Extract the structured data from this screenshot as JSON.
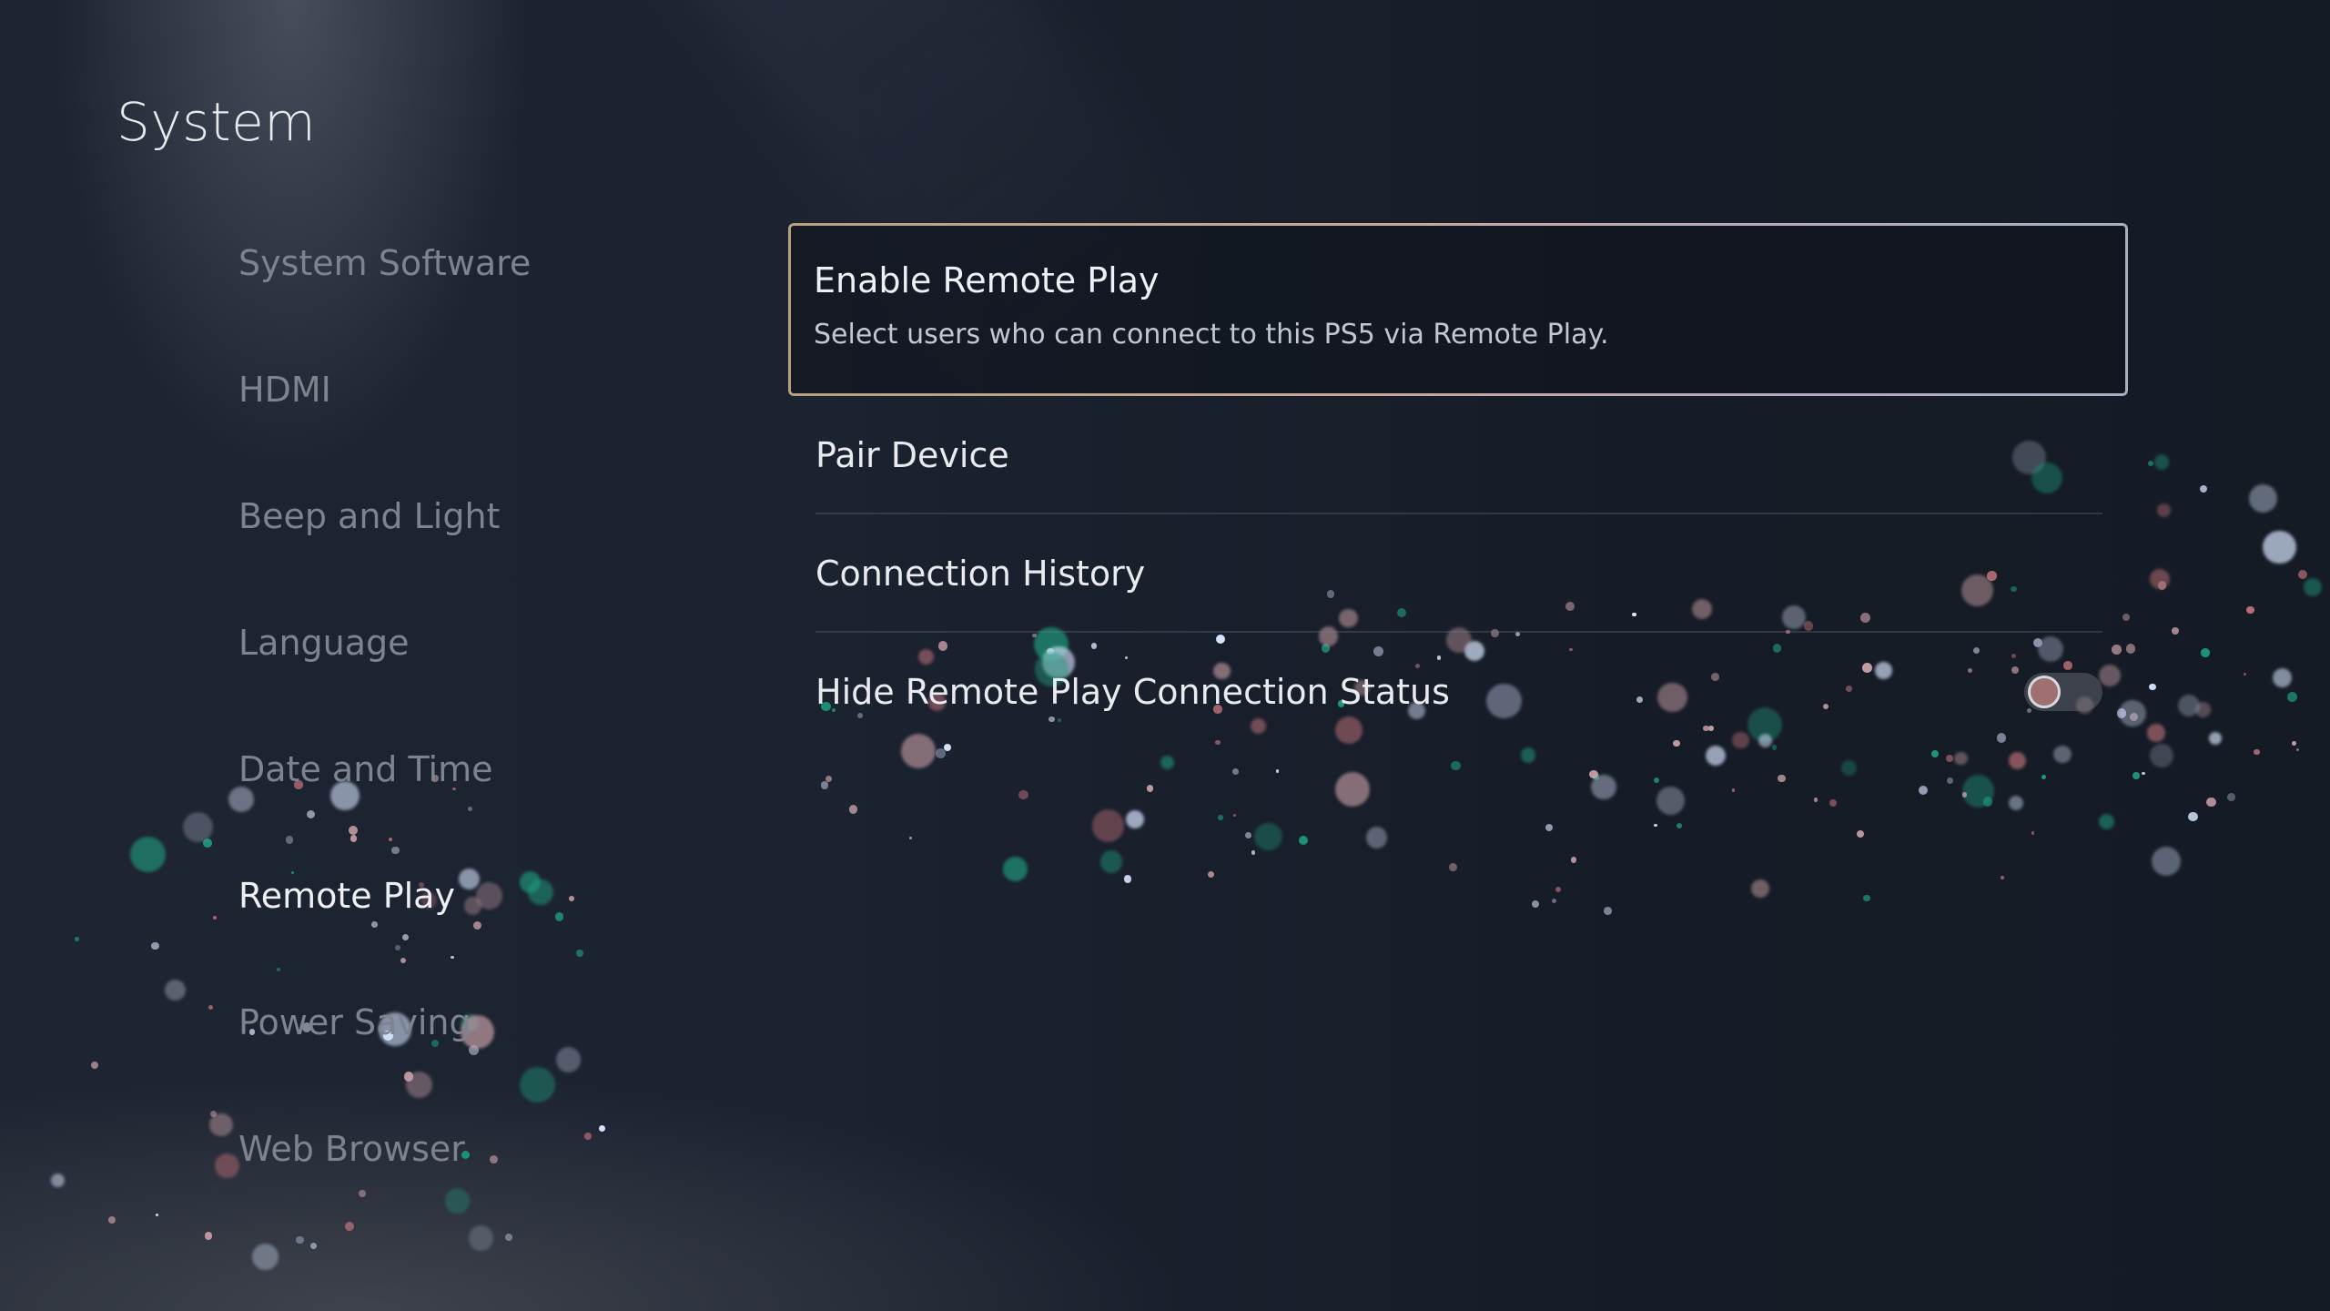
{
  "header": {
    "title": "System"
  },
  "sidebar": {
    "items": [
      {
        "label": "System Software",
        "active": false
      },
      {
        "label": "HDMI",
        "active": false
      },
      {
        "label": "Beep and Light",
        "active": false
      },
      {
        "label": "Language",
        "active": false
      },
      {
        "label": "Date and Time",
        "active": false
      },
      {
        "label": "Remote Play",
        "active": true
      },
      {
        "label": "Power Saving",
        "active": false
      },
      {
        "label": "Web Browser",
        "active": false
      }
    ]
  },
  "main": {
    "selected_item": {
      "title": "Enable Remote Play",
      "description": "Select users who can connect to this PS5 via Remote Play."
    },
    "items": [
      {
        "label": "Pair Device"
      },
      {
        "label": "Connection History"
      },
      {
        "label": "Hide Remote Play Connection Status",
        "toggle": {
          "state": "off"
        }
      }
    ]
  },
  "theme": {
    "focus_border_start": "#b9a07f",
    "focus_border_end": "#a7afc2",
    "text_primary": "#eef0f4",
    "text_dimmed": "#7d838f",
    "particle_teal": "#1f9a7e",
    "particle_pink": "#b86e76"
  }
}
